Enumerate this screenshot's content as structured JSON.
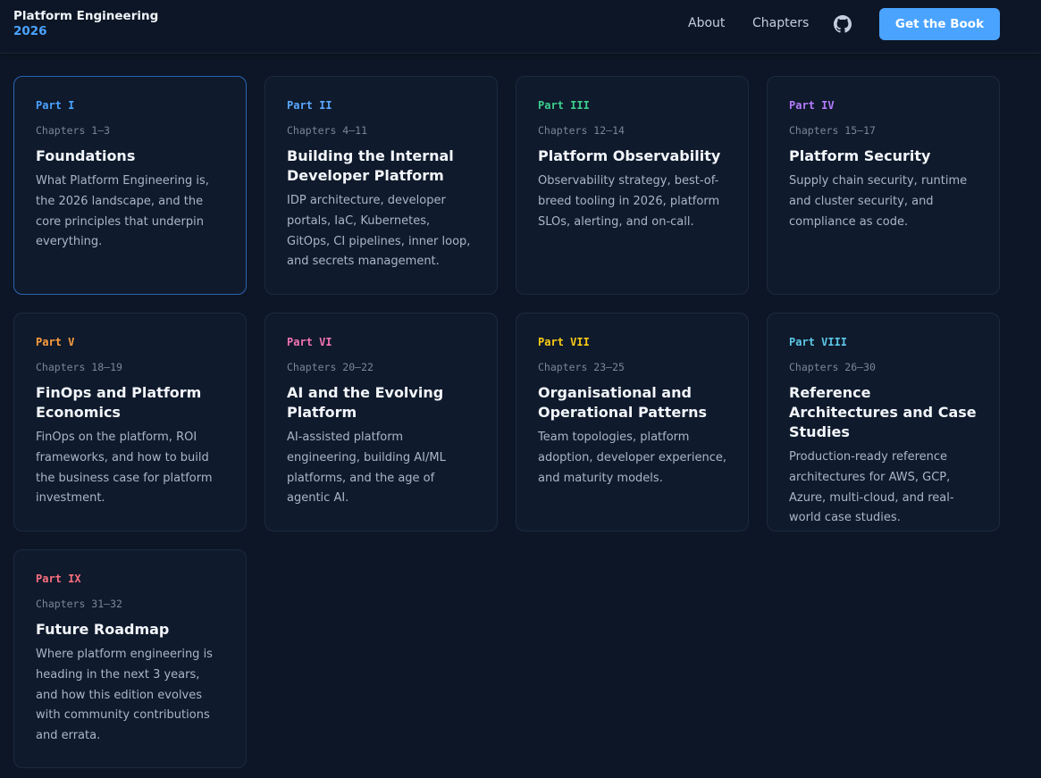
{
  "header": {
    "brand_name": "Platform Engineering",
    "brand_year": "2026",
    "nav": {
      "about": "About",
      "chapters": "Chapters"
    },
    "github_icon": "github-icon",
    "cta_label": "Get the Book"
  },
  "colors": {
    "accent": "#4aa3ff",
    "background": "#0d1626",
    "card": "#0f1a2c"
  },
  "parts": [
    {
      "part": "Part I",
      "chapters": "Chapters 1–3",
      "title": "Foundations",
      "description": "What Platform Engineering is, the 2026 landscape, and the core principles that underpin everything.",
      "color": "#4aa3ff"
    },
    {
      "part": "Part II",
      "chapters": "Chapters 4–11",
      "title": "Building the Internal Developer Platform",
      "description": "IDP architecture, developer portals, IaC, Kubernetes, GitOps, CI pipelines, inner loop, and secrets management.",
      "color": "#5aa8ff"
    },
    {
      "part": "Part III",
      "chapters": "Chapters 12–14",
      "title": "Platform Observability",
      "description": "Observability strategy, best-of-breed tooling in 2026, platform SLOs, alerting, and on-call.",
      "color": "#3ecf8e"
    },
    {
      "part": "Part IV",
      "chapters": "Chapters 15–17",
      "title": "Platform Security",
      "description": "Supply chain security, runtime and cluster security, and compliance as code.",
      "color": "#b57bff"
    },
    {
      "part": "Part V",
      "chapters": "Chapters 18–19",
      "title": "FinOps and Platform Economics",
      "description": "FinOps on the platform, ROI frameworks, and how to build the business case for platform investment.",
      "color": "#ff9d3c"
    },
    {
      "part": "Part VI",
      "chapters": "Chapters 20–22",
      "title": "AI and the Evolving Platform",
      "description": "AI-assisted platform engineering, building AI/ML platforms, and the age of agentic AI.",
      "color": "#f472b6"
    },
    {
      "part": "Part VII",
      "chapters": "Chapters 23–25",
      "title": "Organisational and Operational Patterns",
      "description": "Team topologies, platform adoption, developer experience, and maturity models.",
      "color": "#facc15"
    },
    {
      "part": "Part VIII",
      "chapters": "Chapters 26–30",
      "title": "Reference Architectures and Case Studies",
      "description": "Production-ready reference architectures for AWS, GCP, Azure, multi-cloud, and real-world case studies.",
      "color": "#5cc8e8"
    },
    {
      "part": "Part IX",
      "chapters": "Chapters 31–32",
      "title": "Future Roadmap",
      "description": "Where platform engineering is heading in the next 3 years, and how this edition evolves with community contributions and errata.",
      "color": "#fb6f7f"
    }
  ]
}
